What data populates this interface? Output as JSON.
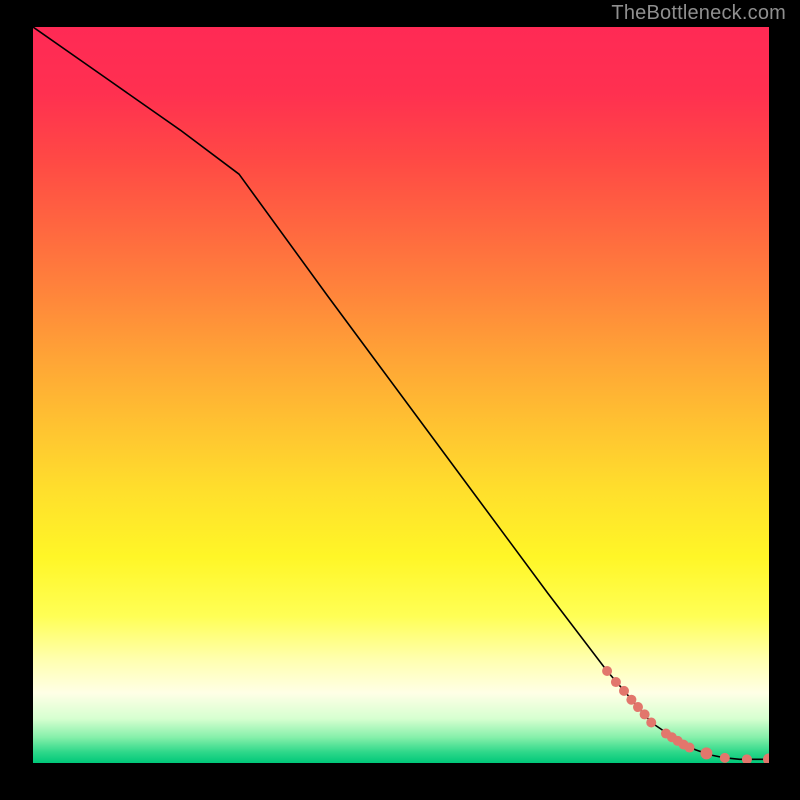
{
  "attribution": "TheBottleneck.com",
  "chart_data": {
    "type": "line",
    "title": "",
    "xlabel": "",
    "ylabel": "",
    "xlim": [
      0,
      100
    ],
    "ylim": [
      0,
      100
    ],
    "background_gradient_stops": [
      {
        "offset": 0.0,
        "color": "#ff2a55"
      },
      {
        "offset": 0.09,
        "color": "#ff3050"
      },
      {
        "offset": 0.18,
        "color": "#ff4945"
      },
      {
        "offset": 0.27,
        "color": "#ff6640"
      },
      {
        "offset": 0.36,
        "color": "#ff843b"
      },
      {
        "offset": 0.45,
        "color": "#ffa436"
      },
      {
        "offset": 0.54,
        "color": "#ffc231"
      },
      {
        "offset": 0.63,
        "color": "#ffdf2c"
      },
      {
        "offset": 0.72,
        "color": "#fff627"
      },
      {
        "offset": 0.8,
        "color": "#ffff55"
      },
      {
        "offset": 0.86,
        "color": "#ffffb0"
      },
      {
        "offset": 0.905,
        "color": "#ffffe6"
      },
      {
        "offset": 0.94,
        "color": "#d6ffd0"
      },
      {
        "offset": 0.965,
        "color": "#86f0aa"
      },
      {
        "offset": 0.985,
        "color": "#2fd88a"
      },
      {
        "offset": 1.0,
        "color": "#00c879"
      }
    ],
    "series": [
      {
        "name": "curve",
        "stroke": "#000000",
        "stroke_width": 1.6,
        "x": [
          0.0,
          10.0,
          20.0,
          28.0,
          40.0,
          50.0,
          60.0,
          70.0,
          78.0,
          84.0,
          88.0,
          90.0,
          92.0,
          94.0,
          96.0,
          98.0,
          100.0
        ],
        "y": [
          100.0,
          93.0,
          86.0,
          80.0,
          63.5,
          50.0,
          36.5,
          23.0,
          12.5,
          5.5,
          2.8,
          1.8,
          1.1,
          0.7,
          0.5,
          0.5,
          0.5
        ]
      }
    ],
    "markers": {
      "color": "#e2766c",
      "points": [
        {
          "x": 78.0,
          "y": 12.5,
          "r": 5
        },
        {
          "x": 79.2,
          "y": 11.0,
          "r": 5
        },
        {
          "x": 80.3,
          "y": 9.8,
          "r": 5
        },
        {
          "x": 81.3,
          "y": 8.6,
          "r": 5
        },
        {
          "x": 82.2,
          "y": 7.6,
          "r": 5
        },
        {
          "x": 83.1,
          "y": 6.6,
          "r": 5
        },
        {
          "x": 84.0,
          "y": 5.5,
          "r": 5
        },
        {
          "x": 86.0,
          "y": 4.0,
          "r": 5
        },
        {
          "x": 86.8,
          "y": 3.5,
          "r": 5
        },
        {
          "x": 87.6,
          "y": 3.0,
          "r": 5
        },
        {
          "x": 88.4,
          "y": 2.5,
          "r": 5
        },
        {
          "x": 89.2,
          "y": 2.1,
          "r": 5
        },
        {
          "x": 91.5,
          "y": 1.3,
          "r": 6
        },
        {
          "x": 94.0,
          "y": 0.7,
          "r": 5
        },
        {
          "x": 97.0,
          "y": 0.5,
          "r": 5
        },
        {
          "x": 100.0,
          "y": 0.5,
          "r": 6
        }
      ]
    }
  }
}
